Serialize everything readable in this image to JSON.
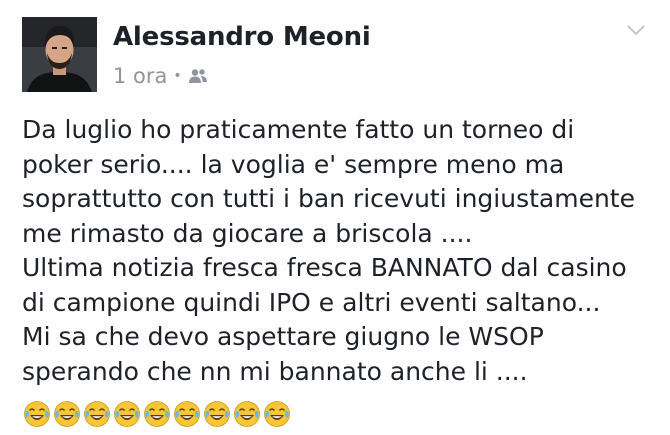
{
  "post": {
    "author": "Alessandro Meoni",
    "time": "1 ora",
    "separator": "•",
    "audience_icon": "friends-icon",
    "lines": [
      "Da luglio ho praticamente fatto un torneo di",
      "poker serio.... la voglia e' sempre meno ma",
      "soprattutto con tutti i ban ricevuti ingiustamente",
      "me rimasto da giocare a briscola ....",
      "Ultima notizia fresca fresca BANNATO dal casino",
      "di campione quindi IPO e altri eventi saltano...",
      "Mi sa che devo aspettare giugno le WSOP",
      "sperando che nn mi bannato anche li ...."
    ],
    "emoji_name": "tears-of-joy-emoji",
    "emoji_count": 9
  },
  "colors": {
    "name_text": "#1d2129",
    "meta_text": "#90949c",
    "body_text": "#1d2129",
    "emoji_face": "#f7c636",
    "emoji_tears": "#6fb8e8"
  }
}
